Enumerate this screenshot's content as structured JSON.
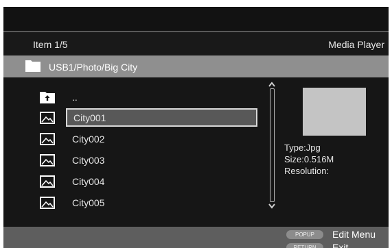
{
  "header": {
    "item_count": "Item 1/5",
    "app_title": "Media Player"
  },
  "path_bar": {
    "path": "USB1/Photo/Big City",
    "icon": "folder-icon"
  },
  "file_list": {
    "items": [
      {
        "label": "..",
        "icon": "parent-folder-icon",
        "selected": false
      },
      {
        "label": "City001",
        "icon": "image-file-icon",
        "selected": true
      },
      {
        "label": "City002",
        "icon": "image-file-icon",
        "selected": false
      },
      {
        "label": "City003",
        "icon": "image-file-icon",
        "selected": false
      },
      {
        "label": "City004",
        "icon": "image-file-icon",
        "selected": false
      },
      {
        "label": "City005",
        "icon": "image-file-icon",
        "selected": false
      }
    ]
  },
  "info": {
    "type": "Type:Jpg",
    "size": "Size:0.516M",
    "resolution": "Resolution:"
  },
  "hints": [
    {
      "key": "POPUP",
      "label": "Edit Menu"
    },
    {
      "key": "RETURN",
      "label": "Exit"
    }
  ],
  "colors": {
    "background": "#161616",
    "path_bar": "#8f8f8f",
    "bottom_bar": "#5e5e5e",
    "selection": "#585858"
  }
}
